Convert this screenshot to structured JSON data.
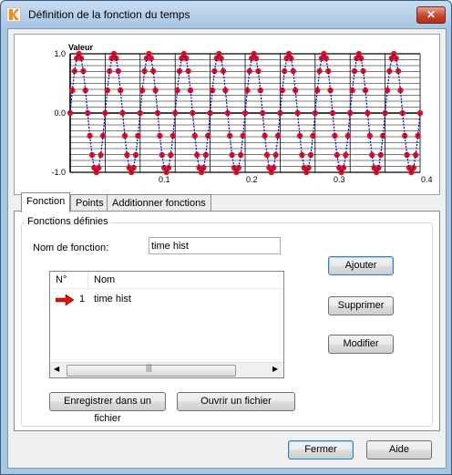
{
  "window": {
    "title": "Définition de la fonction du temps",
    "close_label": "✕"
  },
  "chart_data": {
    "type": "line",
    "ylabel": "Valeur",
    "xlabel": "",
    "xlim": [
      0,
      0.4
    ],
    "ylim": [
      -1.0,
      1.0
    ],
    "x_ticks": [
      "0.1",
      "0.2",
      "0.3",
      "0.4"
    ],
    "y_ticks": [
      "1.0",
      "0.0",
      "-1.0"
    ],
    "grid": true,
    "series": [
      {
        "function": "sine",
        "amplitude": 1.0,
        "frequency": 25,
        "x_start": 0.0,
        "x_end": 0.4,
        "samples_per_cycle": 16,
        "color": "#0000dd",
        "marker_color": "#ee1111"
      }
    ]
  },
  "tabs": [
    {
      "label": "Fonction",
      "active": true
    },
    {
      "label": "Points",
      "active": false
    },
    {
      "label": "Additionner fonctions",
      "active": false
    }
  ],
  "panel": {
    "group_title": "Fonctions définies",
    "name_label": "Nom de fonction:",
    "name_value": "time hist",
    "list": {
      "columns": [
        "N°",
        "Nom"
      ],
      "rows": [
        {
          "num": "1",
          "name": "time hist"
        }
      ]
    },
    "buttons": {
      "add": "Ajouter",
      "delete": "Supprimer",
      "modify": "Modifier",
      "save": "Enregistrer dans un fichier",
      "open": "Ouvrir un fichier"
    }
  },
  "footer": {
    "close": "Fermer",
    "help": "Aide"
  },
  "colors": {
    "title_bar": "#a8c5e2",
    "curve": "#0000dd",
    "points": "#ee1111",
    "arrow": "#dd1111"
  }
}
